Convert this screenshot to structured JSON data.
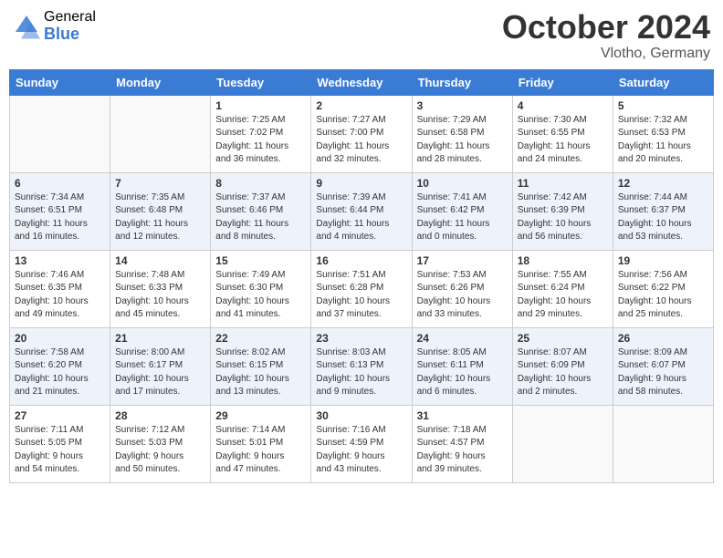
{
  "header": {
    "logo_general": "General",
    "logo_blue": "Blue",
    "month": "October 2024",
    "location": "Vlotho, Germany"
  },
  "days_of_week": [
    "Sunday",
    "Monday",
    "Tuesday",
    "Wednesday",
    "Thursday",
    "Friday",
    "Saturday"
  ],
  "weeks": [
    [
      {
        "day": "",
        "info": ""
      },
      {
        "day": "",
        "info": ""
      },
      {
        "day": "1",
        "info": "Sunrise: 7:25 AM\nSunset: 7:02 PM\nDaylight: 11 hours\nand 36 minutes."
      },
      {
        "day": "2",
        "info": "Sunrise: 7:27 AM\nSunset: 7:00 PM\nDaylight: 11 hours\nand 32 minutes."
      },
      {
        "day": "3",
        "info": "Sunrise: 7:29 AM\nSunset: 6:58 PM\nDaylight: 11 hours\nand 28 minutes."
      },
      {
        "day": "4",
        "info": "Sunrise: 7:30 AM\nSunset: 6:55 PM\nDaylight: 11 hours\nand 24 minutes."
      },
      {
        "day": "5",
        "info": "Sunrise: 7:32 AM\nSunset: 6:53 PM\nDaylight: 11 hours\nand 20 minutes."
      }
    ],
    [
      {
        "day": "6",
        "info": "Sunrise: 7:34 AM\nSunset: 6:51 PM\nDaylight: 11 hours\nand 16 minutes."
      },
      {
        "day": "7",
        "info": "Sunrise: 7:35 AM\nSunset: 6:48 PM\nDaylight: 11 hours\nand 12 minutes."
      },
      {
        "day": "8",
        "info": "Sunrise: 7:37 AM\nSunset: 6:46 PM\nDaylight: 11 hours\nand 8 minutes."
      },
      {
        "day": "9",
        "info": "Sunrise: 7:39 AM\nSunset: 6:44 PM\nDaylight: 11 hours\nand 4 minutes."
      },
      {
        "day": "10",
        "info": "Sunrise: 7:41 AM\nSunset: 6:42 PM\nDaylight: 11 hours\nand 0 minutes."
      },
      {
        "day": "11",
        "info": "Sunrise: 7:42 AM\nSunset: 6:39 PM\nDaylight: 10 hours\nand 56 minutes."
      },
      {
        "day": "12",
        "info": "Sunrise: 7:44 AM\nSunset: 6:37 PM\nDaylight: 10 hours\nand 53 minutes."
      }
    ],
    [
      {
        "day": "13",
        "info": "Sunrise: 7:46 AM\nSunset: 6:35 PM\nDaylight: 10 hours\nand 49 minutes."
      },
      {
        "day": "14",
        "info": "Sunrise: 7:48 AM\nSunset: 6:33 PM\nDaylight: 10 hours\nand 45 minutes."
      },
      {
        "day": "15",
        "info": "Sunrise: 7:49 AM\nSunset: 6:30 PM\nDaylight: 10 hours\nand 41 minutes."
      },
      {
        "day": "16",
        "info": "Sunrise: 7:51 AM\nSunset: 6:28 PM\nDaylight: 10 hours\nand 37 minutes."
      },
      {
        "day": "17",
        "info": "Sunrise: 7:53 AM\nSunset: 6:26 PM\nDaylight: 10 hours\nand 33 minutes."
      },
      {
        "day": "18",
        "info": "Sunrise: 7:55 AM\nSunset: 6:24 PM\nDaylight: 10 hours\nand 29 minutes."
      },
      {
        "day": "19",
        "info": "Sunrise: 7:56 AM\nSunset: 6:22 PM\nDaylight: 10 hours\nand 25 minutes."
      }
    ],
    [
      {
        "day": "20",
        "info": "Sunrise: 7:58 AM\nSunset: 6:20 PM\nDaylight: 10 hours\nand 21 minutes."
      },
      {
        "day": "21",
        "info": "Sunrise: 8:00 AM\nSunset: 6:17 PM\nDaylight: 10 hours\nand 17 minutes."
      },
      {
        "day": "22",
        "info": "Sunrise: 8:02 AM\nSunset: 6:15 PM\nDaylight: 10 hours\nand 13 minutes."
      },
      {
        "day": "23",
        "info": "Sunrise: 8:03 AM\nSunset: 6:13 PM\nDaylight: 10 hours\nand 9 minutes."
      },
      {
        "day": "24",
        "info": "Sunrise: 8:05 AM\nSunset: 6:11 PM\nDaylight: 10 hours\nand 6 minutes."
      },
      {
        "day": "25",
        "info": "Sunrise: 8:07 AM\nSunset: 6:09 PM\nDaylight: 10 hours\nand 2 minutes."
      },
      {
        "day": "26",
        "info": "Sunrise: 8:09 AM\nSunset: 6:07 PM\nDaylight: 9 hours\nand 58 minutes."
      }
    ],
    [
      {
        "day": "27",
        "info": "Sunrise: 7:11 AM\nSunset: 5:05 PM\nDaylight: 9 hours\nand 54 minutes."
      },
      {
        "day": "28",
        "info": "Sunrise: 7:12 AM\nSunset: 5:03 PM\nDaylight: 9 hours\nand 50 minutes."
      },
      {
        "day": "29",
        "info": "Sunrise: 7:14 AM\nSunset: 5:01 PM\nDaylight: 9 hours\nand 47 minutes."
      },
      {
        "day": "30",
        "info": "Sunrise: 7:16 AM\nSunset: 4:59 PM\nDaylight: 9 hours\nand 43 minutes."
      },
      {
        "day": "31",
        "info": "Sunrise: 7:18 AM\nSunset: 4:57 PM\nDaylight: 9 hours\nand 39 minutes."
      },
      {
        "day": "",
        "info": ""
      },
      {
        "day": "",
        "info": ""
      }
    ]
  ]
}
